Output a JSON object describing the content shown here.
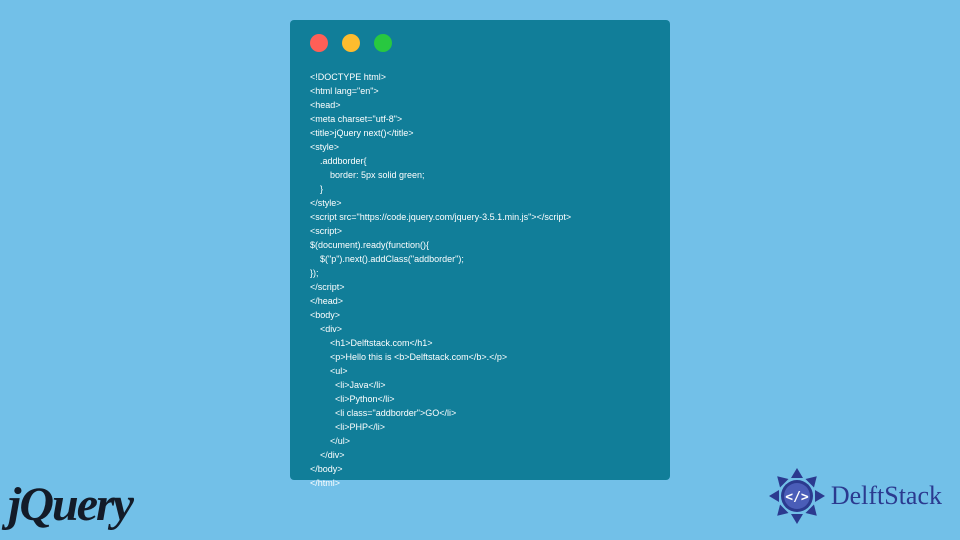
{
  "code_window": {
    "lines": [
      "<!DOCTYPE html>",
      "<html lang=\"en\">",
      "<head>",
      "<meta charset=\"utf-8\">",
      "<title>jQuery next()</title>",
      "<style>",
      "    .addborder{",
      "        border: 5px solid green;",
      "    }",
      "</style>",
      "<script src=\"https://code.jquery.com/jquery-3.5.1.min.js\"></script>",
      "<script>",
      "$(document).ready(function(){",
      "    $(\"p\").next().addClass(\"addborder\");",
      "});",
      "</script>",
      "</head>",
      "<body>",
      "    <div>",
      "        <h1>Delftstack.com</h1>",
      "        <p>Hello this is <b>Delftstack.com</b>.</p>",
      "        <ul>",
      "          <li>Java</li>",
      "          <li>Python</li>",
      "          <li class=\"addborder\">GO</li>",
      "          <li>PHP</li>",
      "        </ul>",
      "    </div>",
      "</body>",
      "</html>"
    ]
  },
  "logos": {
    "jquery": "jQuery",
    "delftstack": "DelftStack"
  }
}
